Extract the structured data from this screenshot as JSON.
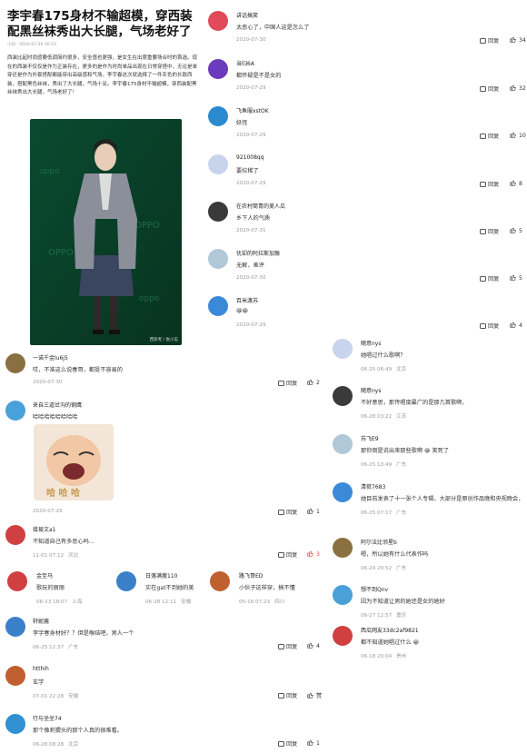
{
  "article": {
    "title": "李宇春175身材不输超模，穿西装配黑丝袜秀出大长腿，气场老好了",
    "meta": "小白 · 2020-07-29 16:53",
    "body": "西装比起时尚感要低调简约很多，安全感也更强，是女生在出席重要场合时的首选。现在的西装不仅仅是作为正装存在，更多的是作为时尚单品出现在日常穿搭中，无论是单穿还是作为外套搭配都能穿出高级感和气场，李宇春这次就选择了一件灰色的长款西装，搭配黑色丝袜，秀出了大长腿，气场十足。李宇春175身材不输超模，穿西装配黑丝袜秀出大长腿，气场老好了！",
    "photo_credit": "西装考 / 张小志"
  },
  "reply_label": "回复",
  "top_comments": [
    {
      "user": "讲话搞笑",
      "text": "太恶心了，中国人这是怎么了",
      "date": "2020-07-30",
      "likes": "34"
    },
    {
      "user": "当归6A",
      "text": "都怀疑是不是女的",
      "date": "2020-07-29",
      "likes": "32"
    },
    {
      "user": "飞鱼服xstOK",
      "text": "妖怪",
      "date": "2020-07-29",
      "likes": "10"
    },
    {
      "user": "921008qq",
      "text": "要拉稀了",
      "date": "2020-07-29",
      "likes": "8"
    },
    {
      "user": "在农村筒青的美人瓜",
      "text": "乡下人的气质",
      "date": "2020-07-31",
      "likes": "5"
    },
    {
      "user": "优却的阿拉斯加猴",
      "text": "无解，差评",
      "date": "2020-07-30",
      "likes": "5"
    },
    {
      "user": "百米渡苏",
      "text": "😀😀",
      "date": "2020-07-29",
      "likes": "4"
    }
  ],
  "left_comments": [
    {
      "user": "一诺千金lu6j5",
      "text": "哎，不准这么说春哥，都挺不容易的",
      "date": "2020-07-30",
      "likes": "2"
    },
    {
      "user": "来自三道岔沟的钢鹰",
      "text": "哈哈哈哈哈哈哈哈",
      "sticker": "哈 哈 哈",
      "date": "2020-07-29",
      "likes": "1"
    },
    {
      "user": "接易文a1",
      "text": "不知道自己有多恶心吗...",
      "date": "11-01 07:12",
      "loc": "河北",
      "likes": "3"
    },
    {
      "user": "轩妮酱",
      "text": "李宇春身材好？？但是喉结吧，男人一个",
      "date": "06-25 12:37",
      "loc": "广东",
      "likes": "4"
    },
    {
      "user": "htthih",
      "text": "玄学",
      "date": "07-01 22:28",
      "loc": "安徽",
      "likes": "赞"
    },
    {
      "user": "行与坐坐74",
      "text": "那个像刺猬头的那个人真的很难看。",
      "date": "06-28 08:28",
      "loc": "北京",
      "likes": "1"
    }
  ],
  "small_comments": [
    {
      "user": "金至马",
      "text": "歌玩的丽丽",
      "date": "06-23 18:07",
      "loc": "上海"
    },
    {
      "user": "日落满瘦110",
      "text": "实在gat不到她的美",
      "date": "06-28 12:11",
      "loc": "安徽"
    },
    {
      "user": "路飞哥ED",
      "text": "小伙子这样穿，搞不懂",
      "date": "05-16 07:23",
      "loc": "四川"
    }
  ],
  "right_comments": [
    {
      "user": "随意nys",
      "text": "她唱过什么歌啊？",
      "date": "06-25 06:49",
      "loc": "北京"
    },
    {
      "user": "随意nys",
      "text": "不好意思，那传唱度最广的是那几首歌啊，",
      "date": "06-28 03:22",
      "loc": "江苏"
    },
    {
      "user": "苏飞E9",
      "text": "那你倒是说出来那些歌啊 😀 笑死了",
      "date": "06-25 13:49",
      "loc": "广东"
    },
    {
      "user": "清荷7683",
      "text": "她目前发表了十一张个人专辑，大部分是原创作品晚和央视晚会，而大多唱的自己原创，你不会视而",
      "date": "06-25 07:17",
      "loc": "广东"
    },
    {
      "user": "阿尔法比邻星b",
      "text": "嗯，所以她有什么代表作吗",
      "date": "06-24 20:52",
      "loc": "广东"
    },
    {
      "user": "想不到Qnv",
      "text": "因为不知道让男的她还是女的她好",
      "date": "06-27 12:57",
      "loc": "重庆"
    },
    {
      "user": "西瓜网友33dc2af9821",
      "text": "都不知道她唱过什么 😀",
      "date": "06-18 20:04",
      "loc": "贵州"
    }
  ],
  "colors": {
    "like_hot": "#e54a3a",
    "meta": "#999999"
  }
}
